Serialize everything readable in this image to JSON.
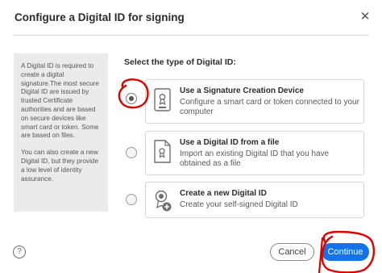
{
  "dialog": {
    "title": "Configure a Digital ID for signing",
    "close_glyph": "✕"
  },
  "side_panel": {
    "paragraph1": "A Digital ID is required to create a digital signature.The most secure Digital ID are issued by trusted Certificate authorities and are based on secure devices like smart card or token. Some are based on files.",
    "paragraph2": "You can also create a new Digital ID, but they provide a low level of identity assurance."
  },
  "section_label": "Select the type of Digital ID:",
  "options": [
    {
      "title": "Use a Signature Creation Device",
      "description": "Configure a smart card or token connected to your computer",
      "icon": "signature-device-icon",
      "selected": true
    },
    {
      "title": "Use a Digital ID from a file",
      "description": "Import an existing Digital ID that you have obtained as a file",
      "icon": "digital-id-file-icon",
      "selected": false
    },
    {
      "title": "Create a new Digital ID",
      "description": "Create your self-signed Digital ID",
      "icon": "new-digital-id-icon",
      "selected": false
    }
  ],
  "footer": {
    "help_glyph": "?",
    "cancel_label": "Cancel",
    "continue_label": "Continue"
  },
  "colors": {
    "accent": "#1473e6",
    "annotation": "#e00000",
    "panel_bg": "#ebebeb"
  }
}
